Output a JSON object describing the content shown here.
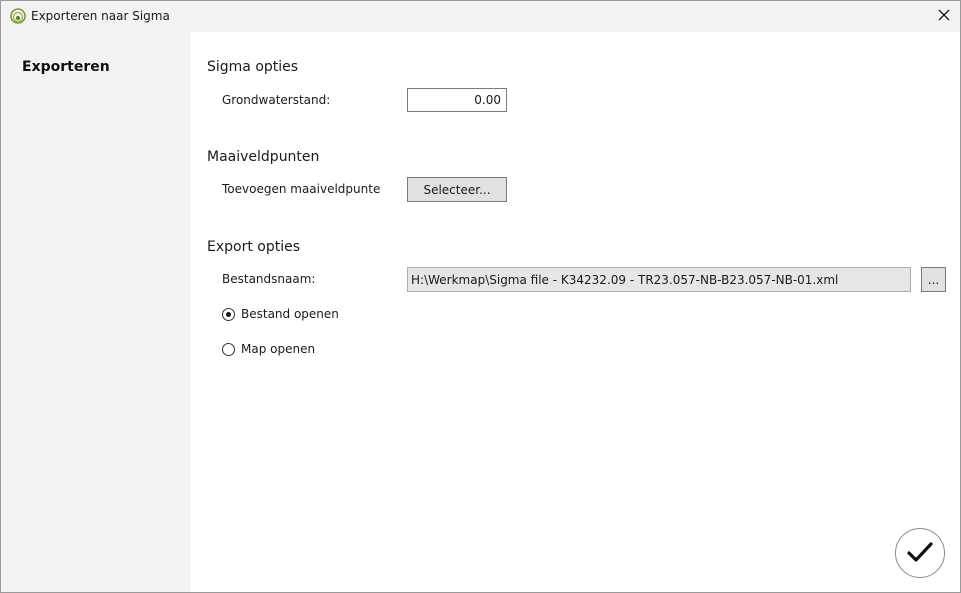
{
  "window": {
    "title": "Exporteren naar Sigma",
    "close_glyph": "✕"
  },
  "sidebar": {
    "items": [
      {
        "label": "Exporteren"
      }
    ]
  },
  "sections": {
    "sigma": {
      "title": "Sigma opties",
      "groundwater_label": "Grondwaterstand:",
      "groundwater_value": "0.00"
    },
    "maaiveld": {
      "title": "Maaiveldpunten",
      "add_label": "Toevoegen maaiveldpunte",
      "select_button": "Selecteer..."
    },
    "export": {
      "title": "Export opties",
      "filename_label": "Bestandsnaam:",
      "filename_value": "H:\\Werkmap\\Sigma file - K34232.09 - TR23.057-NB-B23.057-NB-01.xml",
      "browse_button": "...",
      "options": [
        {
          "label": "Bestand openen",
          "checked": true
        },
        {
          "label": "Map openen",
          "checked": false
        }
      ]
    }
  },
  "icons": {
    "app": "app-logo-icon",
    "close": "close-icon",
    "confirm": "checkmark-icon"
  },
  "colors": {
    "sidebar_bg": "#f3f3f3",
    "content_bg": "#ffffff",
    "button_bg": "#e1e1e1",
    "readonly_bg": "#e6e6e6"
  }
}
